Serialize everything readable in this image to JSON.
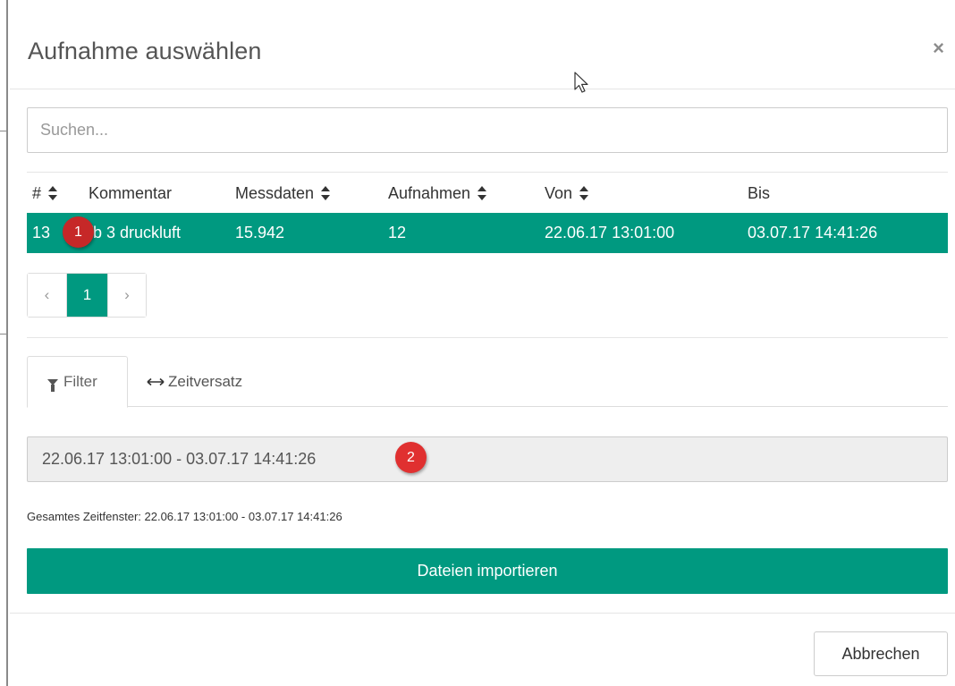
{
  "dialog": {
    "title": "Aufnahme auswählen",
    "close_label": "×"
  },
  "search": {
    "placeholder": "Suchen..."
  },
  "table": {
    "headers": {
      "id": "#",
      "comment": "Kommentar",
      "measurements": "Messdaten",
      "recordings": "Aufnahmen",
      "from": "Von",
      "to": "Bis"
    },
    "rows": [
      {
        "id": "13",
        "comment": "fb 3 druckluft",
        "measurements": "15.942",
        "recordings": "12",
        "from": "22.06.17 13:01:00",
        "to": "03.07.17 14:41:26"
      }
    ]
  },
  "pagination": {
    "prev": "‹",
    "current": "1",
    "next": "›"
  },
  "tabs": [
    {
      "label": "Filter",
      "icon": "filter-icon"
    },
    {
      "label": "Zeitversatz",
      "icon": "arrows-horizontal-icon"
    }
  ],
  "filter": {
    "range": "22.06.17 13:01:00 - 03.07.17 14:41:26",
    "total_window": "Gesamtes Zeitfenster: 22.06.17 13:01:00 - 03.07.17 14:41:26"
  },
  "annotations": {
    "badge1": "1",
    "badge2": "2"
  },
  "buttons": {
    "import": "Dateien importieren",
    "cancel": "Abbrechen"
  },
  "colors": {
    "accent": "#009980",
    "badge": "#c62828"
  }
}
